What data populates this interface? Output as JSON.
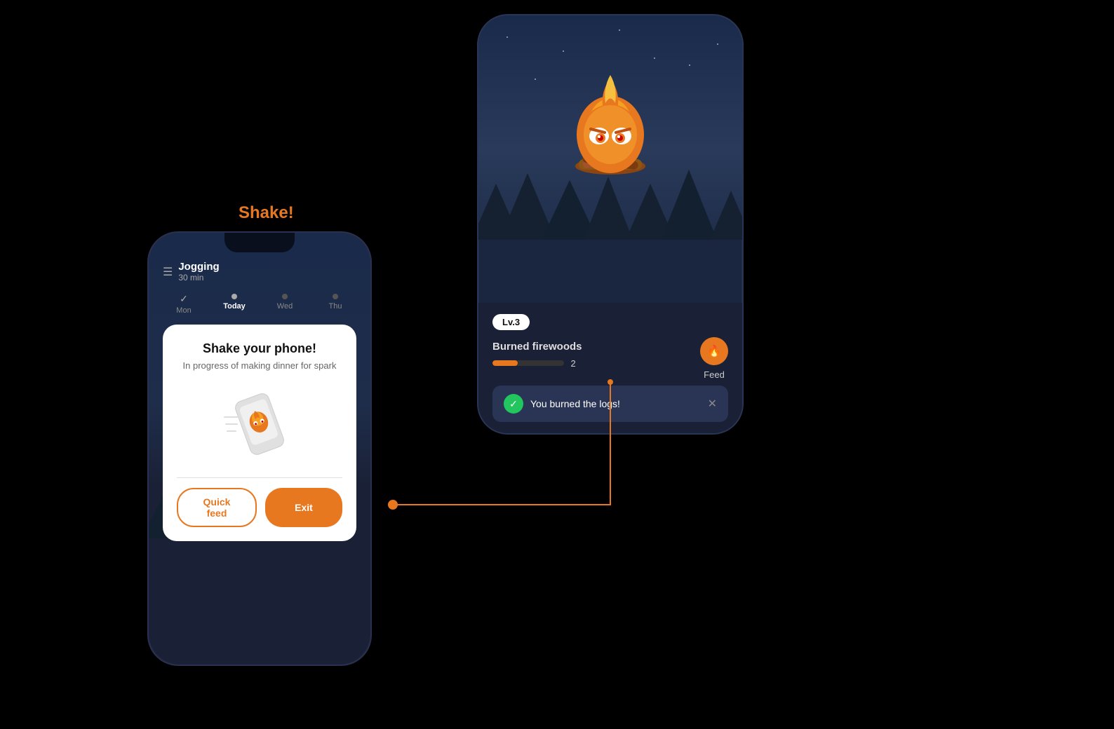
{
  "page": {
    "background": "#000"
  },
  "shake_label": "Shake!",
  "left_phone": {
    "activity": {
      "title": "Jogging",
      "subtitle": "30 min"
    },
    "days": [
      {
        "label": "Mon",
        "state": "completed",
        "today": false
      },
      {
        "label": "Today",
        "state": "active",
        "today": true
      },
      {
        "label": "Wed",
        "state": "dot",
        "today": false
      },
      {
        "label": "Thu",
        "state": "dot",
        "today": false
      }
    ],
    "modal": {
      "title": "Shake your phone!",
      "subtitle": "In progress of making dinner for spark",
      "buttons": {
        "quick_feed": "Quick feed",
        "exit": "Exit"
      }
    }
  },
  "right_phone": {
    "level_badge": "Lv.3",
    "burned_firewoods_label": "Burned firewoods",
    "progress_value": 35,
    "progress_count": "2",
    "feed_label": "Feed",
    "success_message": "You burned the logs!"
  }
}
